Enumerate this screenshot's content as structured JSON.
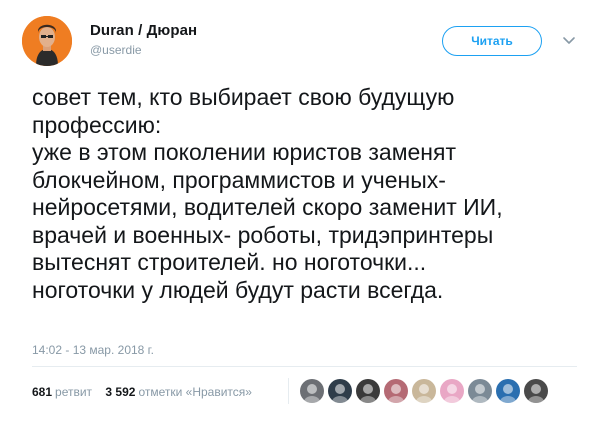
{
  "tweet": {
    "display_name": "Duran / Дюран",
    "handle": "@userdie",
    "follow_label": "Читать",
    "lines": [
      "совет тем, кто выбирает свою будущую",
      "профессию:",
      "уже в этом поколении юристов заменят",
      "блокчейном, программистов и ученых-",
      "нейросетями, водителей скоро заменит ИИ,",
      "врачей и военных- роботы, тридэпринтеры",
      "вытеснят строителей. но ноготочки...",
      "ноготочки у людей будут расти всегда."
    ],
    "timestamp": "14:02 - 13 мар. 2018 г.",
    "retweets_count": "681",
    "retweets_label": "ретвит",
    "likes_count": "3 592",
    "likes_label": "отметки «Нравится»"
  },
  "likers": [
    {
      "icon": "avatar-1",
      "color": "#6c6f74"
    },
    {
      "icon": "avatar-2",
      "color": "#2f3d4a"
    },
    {
      "icon": "avatar-3",
      "color": "#3a3a3a"
    },
    {
      "icon": "avatar-4",
      "color": "#b56a74"
    },
    {
      "icon": "avatar-5",
      "color": "#c9b79a"
    },
    {
      "icon": "avatar-6",
      "color": "#e9a7c5"
    },
    {
      "icon": "avatar-7",
      "color": "#7b8a96"
    },
    {
      "icon": "avatar-8",
      "color": "#2a6fb0"
    },
    {
      "icon": "avatar-9",
      "color": "#4a4a4a"
    }
  ],
  "colors": {
    "accent": "#1da1f2",
    "muted": "#8899a6",
    "avatar_bg": "#ef7d22"
  }
}
